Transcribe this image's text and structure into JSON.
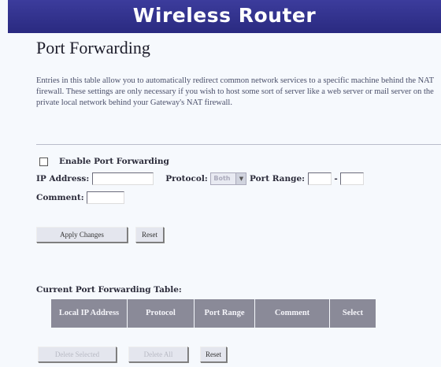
{
  "header": {
    "banner_title": "Wireless Router"
  },
  "page": {
    "title": "Port Forwarding",
    "description": "Entries in this table allow you to automatically redirect common network services to a specific machine behind the NAT firewall. These settings are only necessary if you wish to host some sort of server like a web server or mail server on the private local network behind your Gateway's NAT firewall."
  },
  "form": {
    "enable_label": "Enable Port Forwarding",
    "enabled": false,
    "ip_label": "IP Address:",
    "ip_value": "",
    "protocol_label": "Protocol:",
    "protocol_selected": "Both",
    "port_range_label": "Port Range:",
    "port_from": "",
    "port_separator": "-",
    "port_to": "",
    "comment_label": "Comment:",
    "comment_value": ""
  },
  "buttons": {
    "apply": "Apply Changes",
    "reset": "Reset",
    "delete_selected": "Delete Selected",
    "delete_all": "Delete All",
    "reset_table": "Reset"
  },
  "table": {
    "title": "Current Port Forwarding Table:",
    "columns": [
      "Local IP Address",
      "Protocol",
      "Port Range",
      "Comment",
      "Select"
    ],
    "rows": []
  }
}
